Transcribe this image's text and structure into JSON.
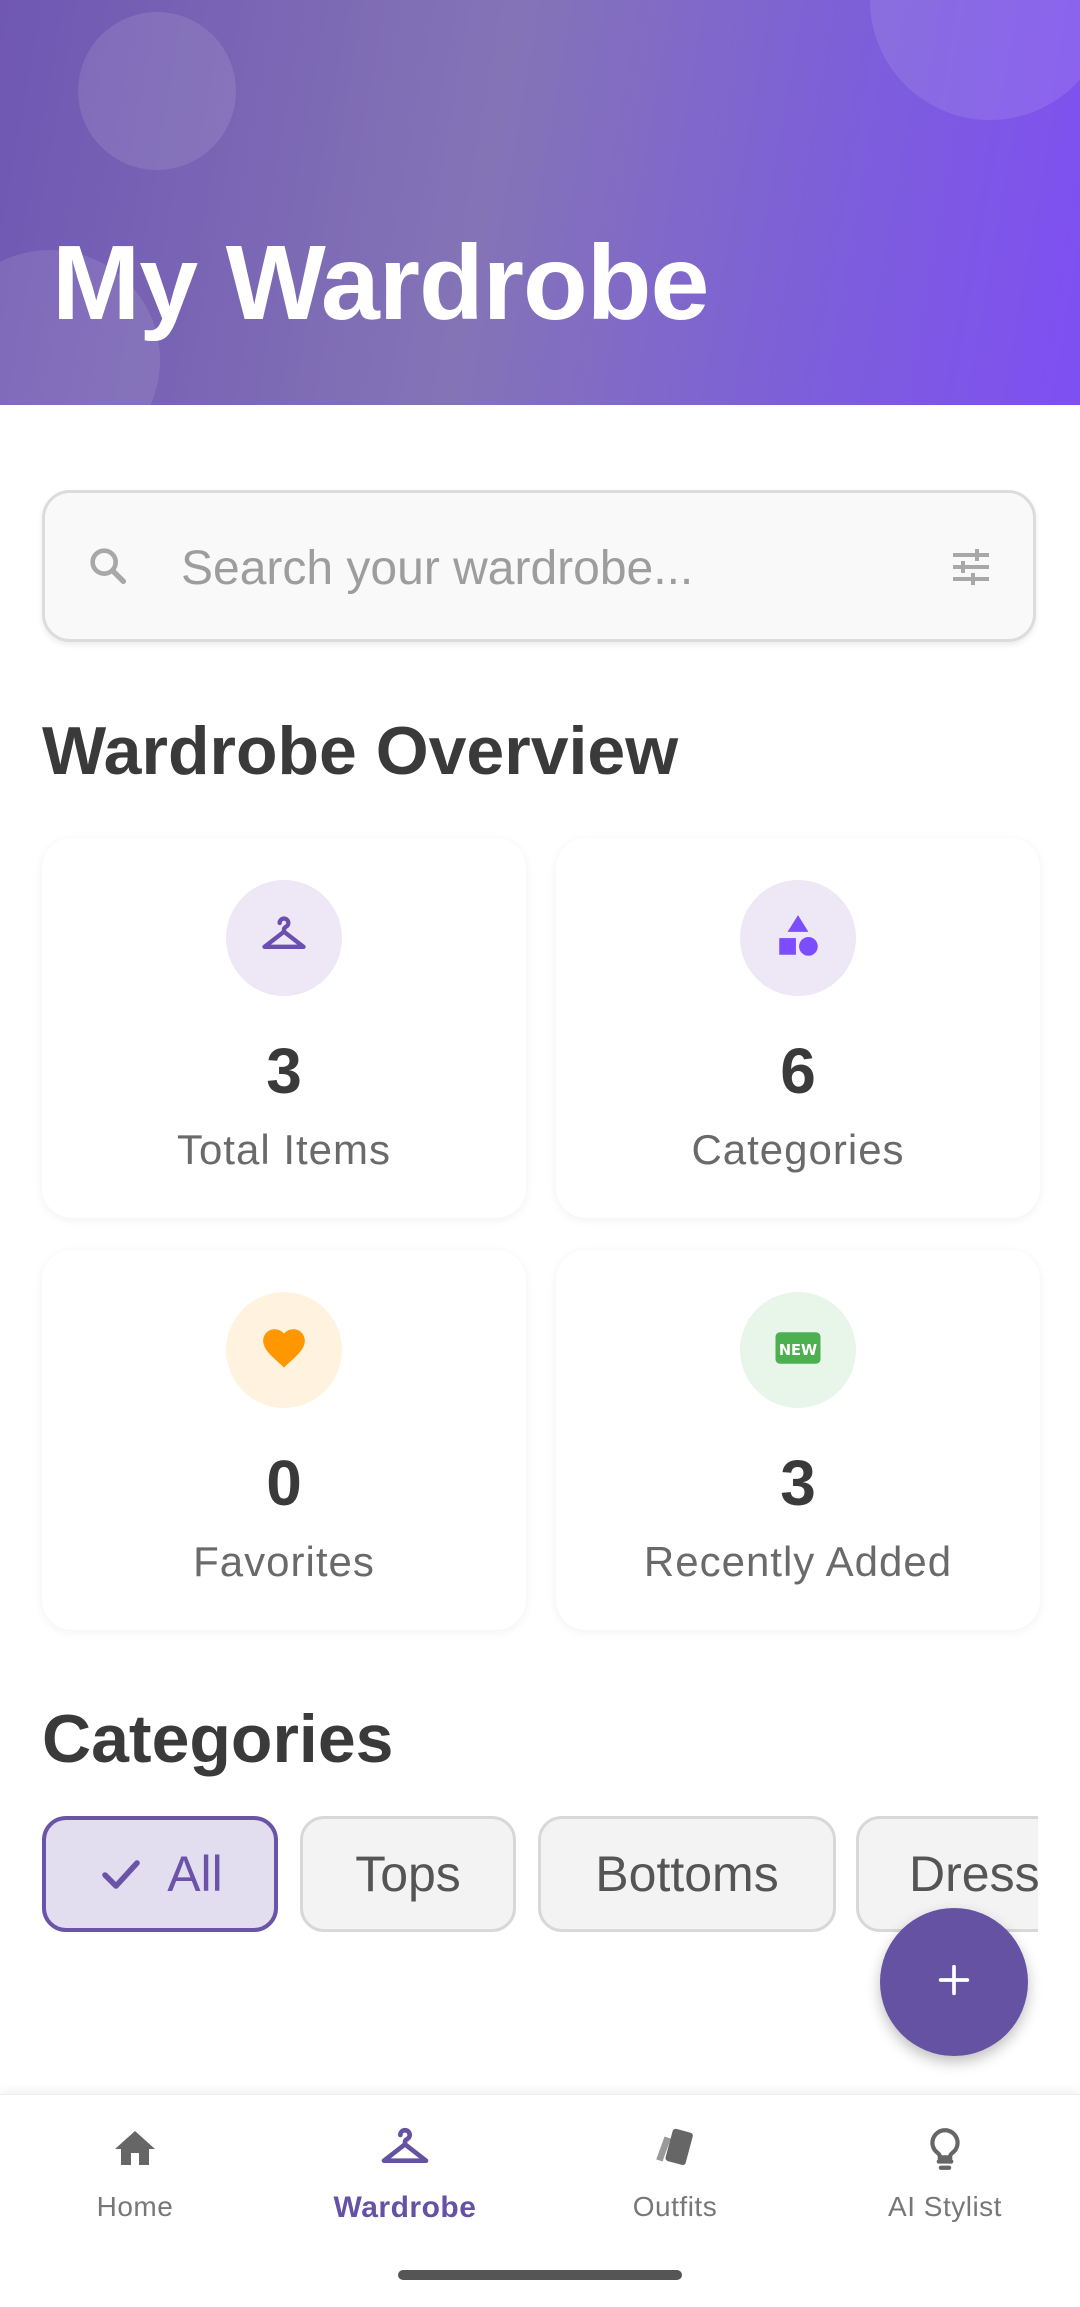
{
  "header": {
    "title": "My Wardrobe"
  },
  "search": {
    "placeholder": "Search your wardrobe...",
    "search_icon": "search-icon",
    "filter_icon": "tune-icon"
  },
  "overview": {
    "title": "Wardrobe Overview",
    "cards": [
      {
        "value": "3",
        "label": "Total Items",
        "icon": "hanger-icon",
        "icon_color": "#6a4fb0",
        "circle_color": "#ede7f6"
      },
      {
        "value": "6",
        "label": "Categories",
        "icon": "shapes-icon",
        "icon_color": "#7c4dff",
        "circle_color": "#ede7f6"
      },
      {
        "value": "0",
        "label": "Favorites",
        "icon": "heart-icon",
        "icon_color": "#ff9800",
        "circle_color": "#fff3e0"
      },
      {
        "value": "3",
        "label": "Recently Added",
        "icon": "new-badge-icon",
        "icon_color": "#4caf50",
        "circle_color": "#e8f5e9"
      }
    ]
  },
  "categories": {
    "title": "Categories",
    "chips": [
      {
        "label": "All",
        "selected": true
      },
      {
        "label": "Tops",
        "selected": false
      },
      {
        "label": "Bottoms",
        "selected": false
      },
      {
        "label": "Dress",
        "selected": false
      }
    ]
  },
  "fab": {
    "icon": "plus-icon"
  },
  "bottom_nav": {
    "items": [
      {
        "label": "Home",
        "icon": "home-icon",
        "active": false
      },
      {
        "label": "Wardrobe",
        "icon": "hanger-icon",
        "active": true
      },
      {
        "label": "Outfits",
        "icon": "style-cards-icon",
        "active": false
      },
      {
        "label": "AI Stylist",
        "icon": "lightbulb-icon",
        "active": false
      }
    ]
  },
  "colors": {
    "accent": "#6552a3",
    "header_gradient_start": "#6f57b3",
    "header_gradient_end": "#7e4ff3"
  }
}
